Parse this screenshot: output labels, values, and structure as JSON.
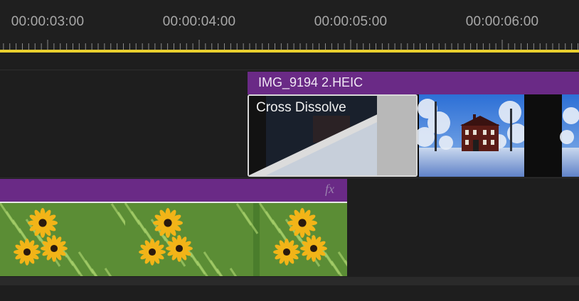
{
  "ruler": {
    "timecodes": [
      "00:00:03:00",
      "00:00:04:00",
      "00:00:05:00",
      "00:00:06:00"
    ]
  },
  "tracks": {
    "v2_clip": {
      "name": "IMG_9194 2.HEIC",
      "thumbnail_icon": "house-in-snow-thumbnail"
    },
    "transition": {
      "label": "Cross Dissolve"
    },
    "v1_clip": {
      "fx_badge": "fx",
      "thumbnail_icon": "black-eyed-susan-flowers-thumbnail"
    }
  },
  "colors": {
    "playhead_bar": "#e9cf2e",
    "clip_header": "#6a2a86",
    "background": "#1e1e1e"
  }
}
